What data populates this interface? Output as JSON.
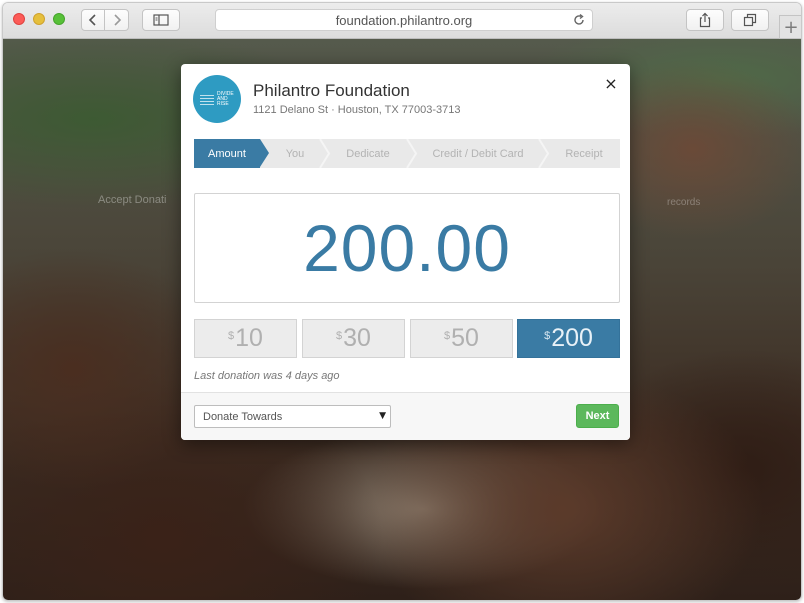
{
  "browser": {
    "url": "foundation.philantro.org",
    "new_tab_symbol": "+"
  },
  "background": {
    "sign_left": "Accept Donati",
    "sign_right": "records"
  },
  "modal": {
    "org_name": "Philantro Foundation",
    "org_address": "1121 Delano St · Houston, TX 77003-3713",
    "logo_text": "DIVIDE AND RISE",
    "close_symbol": "×",
    "steps": [
      {
        "label": "Amount",
        "active": true
      },
      {
        "label": "You",
        "active": false
      },
      {
        "label": "Dedicate",
        "active": false
      },
      {
        "label": "Credit / Debit Card",
        "active": false
      },
      {
        "label": "Receipt",
        "active": false
      }
    ],
    "amount": "200.00",
    "currency_symbol": "$",
    "presets": [
      {
        "value": "10",
        "selected": false
      },
      {
        "value": "30",
        "selected": false
      },
      {
        "value": "50",
        "selected": false
      },
      {
        "value": "200",
        "selected": true
      }
    ],
    "last_donation": "Last donation was 4 days ago",
    "donate_towards": {
      "selected": "Donate Towards",
      "caret": "▼"
    },
    "next_label": "Next"
  },
  "colors": {
    "accent": "#3a7ba4",
    "logo": "#2e9bc2",
    "next": "#5cb85c"
  }
}
